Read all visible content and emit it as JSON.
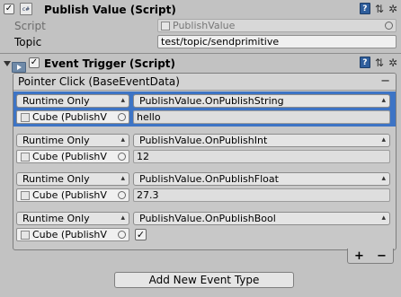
{
  "publish_component": {
    "title": "Publish Value (Script)",
    "enabled_mark": "✓",
    "fields": [
      {
        "label": "Script",
        "value": "PublishValue"
      },
      {
        "label": "Topic",
        "value": "test/topic/sendprimitive"
      }
    ]
  },
  "event_trigger": {
    "title": "Event Trigger (Script)",
    "enabled_mark": "✓",
    "event_type": "Pointer Click (BaseEventData)",
    "remove_symbol": "−",
    "entries": [
      {
        "mode": "Runtime Only",
        "function": "PublishValue.OnPublishString",
        "target": "Cube (PublishV",
        "value": "hello"
      },
      {
        "mode": "Runtime Only",
        "function": "PublishValue.OnPublishInt",
        "target": "Cube (PublishV",
        "value": "12"
      },
      {
        "mode": "Runtime Only",
        "function": "PublishValue.OnPublishFloat",
        "target": "Cube (PublishV",
        "value": "27.3"
      },
      {
        "mode": "Runtime Only",
        "function": "PublishValue.OnPublishBool",
        "target": "Cube (PublishV",
        "checked": true,
        "check_mark": "✓"
      }
    ],
    "add_symbol": "+",
    "minus_symbol": "−"
  },
  "header_icons": {
    "help": "?",
    "settings": "✲"
  },
  "add_button_label": "Add New Event Type"
}
